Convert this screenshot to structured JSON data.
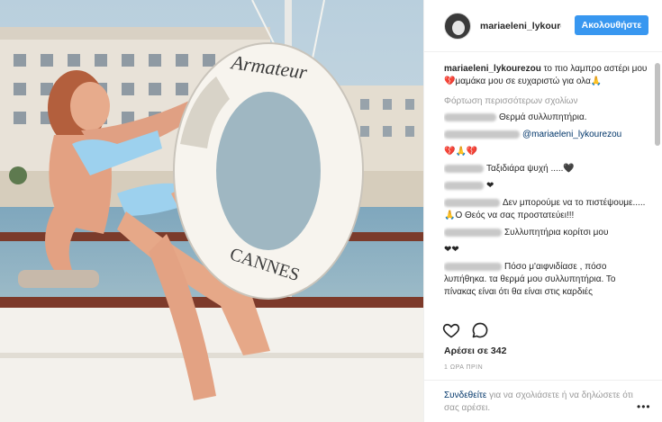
{
  "post": {
    "image_alt": "Vintage photo of woman in blue bikini on yacht with Armateur Cannes life ring",
    "lifebuoy_top_text": "Armateur",
    "lifebuoy_bottom_text": "CANNES"
  },
  "header": {
    "username": "mariaeleni_lykoure",
    "follow_label": "Ακολουθήστε"
  },
  "caption": {
    "username": "mariaeleni_lykourezou",
    "text": " το πιο λαμπρο αστέρι μου💔μαμάκα μου σε ευχαριστώ για ολα🙏"
  },
  "load_more": "Φόρτωση περισσότερων σχολίων",
  "comments": [
    {
      "text": "Θερμά συλλυπητήρια."
    },
    {
      "mention": "@mariaeleni_lykourezou"
    },
    {
      "text": "💔🙏💔"
    },
    {
      "text": "Ταξιδιάρα ψυχή .....🖤"
    },
    {
      "text": "❤"
    },
    {
      "text": "Δεν μπορούμε να το πιστέψουμε.....🙏Ο Θεός να σας προστατεύει!!!"
    },
    {
      "text": "Συλλυπητήρια κορίτσι μου"
    },
    {
      "text": "❤❤"
    },
    {
      "text": "Πόσο μ'αιφνιδίασε , πόσο λυπήθηκα. τα θερμά μου συλλυπητήρια. Το πίνακας είναι ότι θα είναι στις καρδιές"
    }
  ],
  "likes": "Αρέσει σε 342",
  "time": "1 ΩΡΑ ΠΡΙΝ",
  "login": {
    "link": "Συνδεθείτε",
    "text": " για να σχολιάσετε ή να δηλώσετε ότι σας αρέσει."
  },
  "more": "•••",
  "colors": {
    "accent": "#3897f0",
    "link": "#003569",
    "muted": "#999999"
  }
}
